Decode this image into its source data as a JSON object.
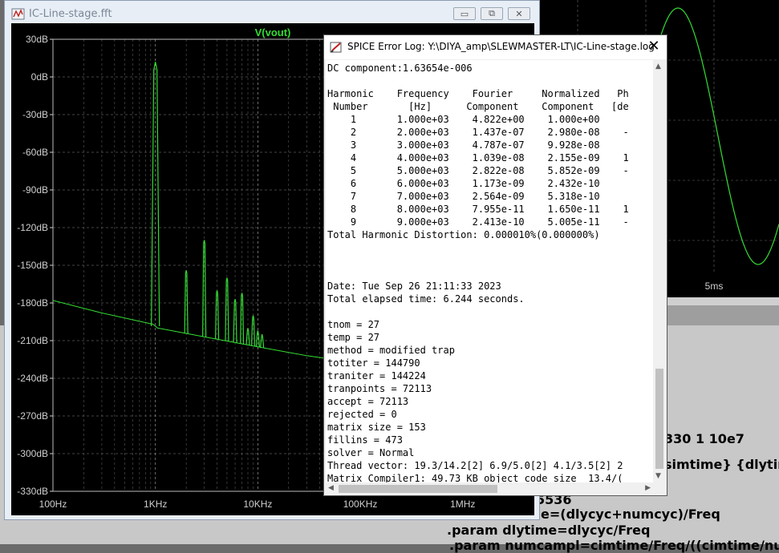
{
  "fft_window": {
    "title": "IC-Line-stage.fft",
    "trace_label": "V(vout)",
    "trace_color": "#33dd33",
    "buttons": {
      "minimize": "▭",
      "maximize": "⧉",
      "close": "✕"
    }
  },
  "chart_data": {
    "type": "line",
    "title": "V(vout)",
    "xlabel": "",
    "ylabel": "",
    "x_scale": "log",
    "xlim": [
      100,
      5000000
    ],
    "ylim": [
      -330,
      30
    ],
    "x_ticks": [
      {
        "label": "100Hz",
        "value": 100
      },
      {
        "label": "1KHz",
        "value": 1000
      },
      {
        "label": "10KHz",
        "value": 10000
      },
      {
        "label": "100KHz",
        "value": 100000
      },
      {
        "label": "1MHz",
        "value": 1000000
      }
    ],
    "y_ticks": [
      {
        "label": "30dB",
        "value": 30
      },
      {
        "label": "0dB",
        "value": 0
      },
      {
        "label": "-30dB",
        "value": -30
      },
      {
        "label": "-60dB",
        "value": -60
      },
      {
        "label": "-90dB",
        "value": -90
      },
      {
        "label": "-120dB",
        "value": -120
      },
      {
        "label": "-150dB",
        "value": -150
      },
      {
        "label": "-180dB",
        "value": -180
      },
      {
        "label": "-210dB",
        "value": -210
      },
      {
        "label": "-240dB",
        "value": -240
      },
      {
        "label": "-270dB",
        "value": -270
      },
      {
        "label": "-300dB",
        "value": -300
      },
      {
        "label": "-330dB",
        "value": -330
      }
    ],
    "grid": true,
    "noise_floor": [
      [
        100,
        -178
      ],
      [
        300,
        -188
      ],
      [
        950,
        -197
      ],
      [
        1050,
        -200
      ],
      [
        3000,
        -207
      ],
      [
        10000,
        -215
      ],
      [
        30000,
        -222
      ],
      [
        100000,
        -228
      ],
      [
        400000,
        -232
      ]
    ],
    "series": [
      {
        "name": "V(vout)",
        "color": "#33dd33",
        "peaks": [
          {
            "x": 1000,
            "y": 12
          },
          {
            "x": 2000,
            "y": -154
          },
          {
            "x": 3000,
            "y": -130
          },
          {
            "x": 4000,
            "y": -170
          },
          {
            "x": 5000,
            "y": -160
          },
          {
            "x": 6000,
            "y": -177
          },
          {
            "x": 7000,
            "y": -172
          },
          {
            "x": 8000,
            "y": -200
          },
          {
            "x": 9000,
            "y": -190
          },
          {
            "x": 10000,
            "y": -202
          },
          {
            "x": 11000,
            "y": -205
          }
        ]
      }
    ]
  },
  "log_window": {
    "title": "SPICE Error Log: Y:\\DIYA_amp\\SLEWMASTER-LT\\IC-Line-stage.log",
    "close_glyph": "✕",
    "lines": [
      "DC component:1.63654e-006",
      "",
      "Harmonic    Frequency    Fourier     Normalized   Ph",
      " Number       [Hz]      Component    Component   [de",
      "    1       1.000e+03    4.822e+00    1.000e+00",
      "    2       2.000e+03    1.437e-07    2.980e-08    -",
      "    3       3.000e+03    4.787e-07    9.928e-08",
      "    4       4.000e+03    1.039e-08    2.155e-09    1",
      "    5       5.000e+03    2.822e-08    5.852e-09    -",
      "    6       6.000e+03    1.173e-09    2.432e-10",
      "    7       7.000e+03    2.564e-09    5.318e-10",
      "    8       8.000e+03    7.955e-11    1.650e-11    1",
      "    9       9.000e+03    2.413e-10    5.005e-11    -",
      "Total Harmonic Distortion: 0.000010%(0.000000%)",
      "",
      "",
      "",
      "Date: Tue Sep 26 21:11:33 2023",
      "Total elapsed time: 6.244 seconds.",
      "",
      "tnom = 27",
      "temp = 27",
      "method = modified trap",
      "totiter = 144790",
      "traniter = 144224",
      "tranpoints = 72113",
      "accept = 72113",
      "rejected = 0",
      "matrix size = 153",
      "fillins = 473",
      "solver = Normal",
      "Thread vector: 19.3/14.2[2] 6.9/5.0[2] 4.1/3.5[2] 2",
      "Matrix Compiler1: 49.73 KB object code size  13.4/("
    ]
  },
  "waveform_window": {
    "x_tick_label": "5ms",
    "trace_color": "#33dd33"
  },
  "netlist": {
    "lines": [
      "330 1 10e7",
      "simtime} {dlytime",
      "5536",
      "e=(dlycyc+numcyc)/Freq",
      ".param dlytime=dlycyc/Freq",
      ".param numcampl=cimtime/Freq/((cimtime/numcy"
    ]
  }
}
